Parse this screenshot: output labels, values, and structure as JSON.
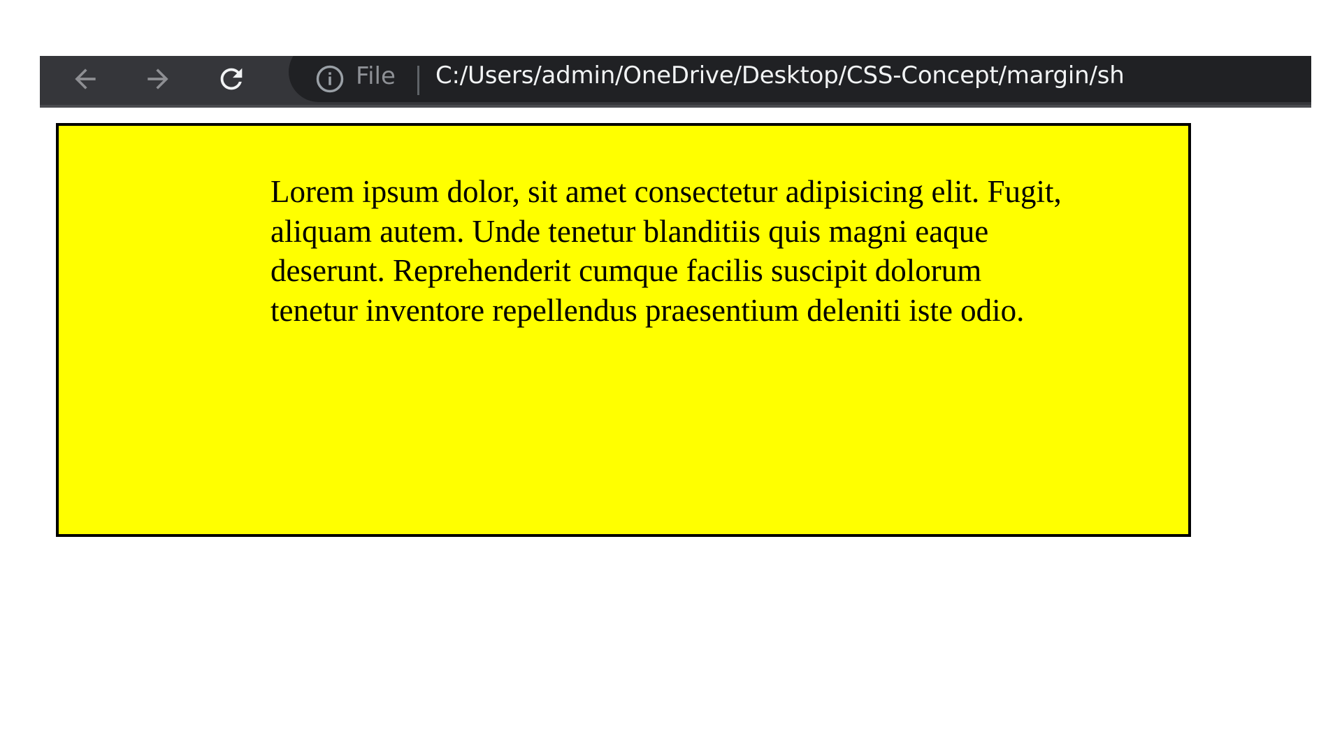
{
  "browser": {
    "scheme_label": "File",
    "url": "C:/Users/admin/OneDrive/Desktop/CSS-Concept/margin/sh",
    "icons": {
      "back": "back-arrow-icon",
      "forward": "forward-arrow-icon",
      "reload": "reload-icon",
      "info": "info-icon"
    },
    "colors": {
      "toolbar": "#35363a",
      "omnibox": "#202124",
      "url_text": "#f1f3f4"
    }
  },
  "content": {
    "box_color": "#ffff00",
    "border_color": "#000000",
    "paragraph": "Lorem ipsum dolor, sit amet consectetur adipisicing elit. Fugit, aliquam autem. Unde tenetur blanditiis quis magni eaque deserunt. Reprehenderit cumque facilis suscipit dolorum tenetur inventore repellendus praesentium deleniti iste odio."
  }
}
